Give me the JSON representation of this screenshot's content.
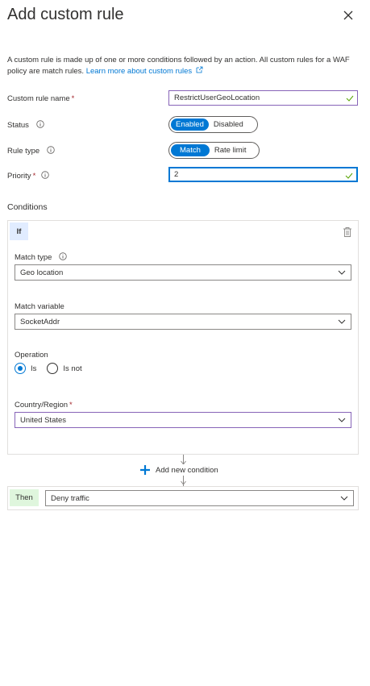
{
  "header": {
    "title": "Add custom rule",
    "close_icon": "close-icon"
  },
  "description": {
    "text": "A custom rule is made up of one or more conditions followed by an action. All custom rules for a WAF policy are match rules.",
    "link": "Learn more about custom rules"
  },
  "form": {
    "name_label": "Custom rule name",
    "name_value": "RestrictUserGeoLocation",
    "status_label": "Status",
    "status_options": [
      "Enabled",
      "Disabled"
    ],
    "status_selected": "Enabled",
    "ruletype_label": "Rule type",
    "ruletype_options": [
      "Match",
      "Rate limit"
    ],
    "ruletype_selected": "Match",
    "priority_label": "Priority",
    "priority_value": "2",
    "required_mark": "*"
  },
  "conditions": {
    "heading": "Conditions",
    "if_label": "If",
    "match_type_label": "Match type",
    "match_type_value": "Geo location",
    "match_variable_label": "Match variable",
    "match_variable_value": "SocketAddr",
    "operation_label": "Operation",
    "operation_options": [
      "Is",
      "Is not"
    ],
    "operation_selected": "Is",
    "country_label": "Country/Region",
    "country_value": "United States",
    "add_condition_label": "Add new condition"
  },
  "then": {
    "label": "Then",
    "value": "Deny traffic"
  },
  "colors": {
    "accent": "#0078d4",
    "required": "#a4262c",
    "valid_check": "#57a300",
    "if_badge": "#e1ecff",
    "then_badge": "#dff6dd"
  }
}
